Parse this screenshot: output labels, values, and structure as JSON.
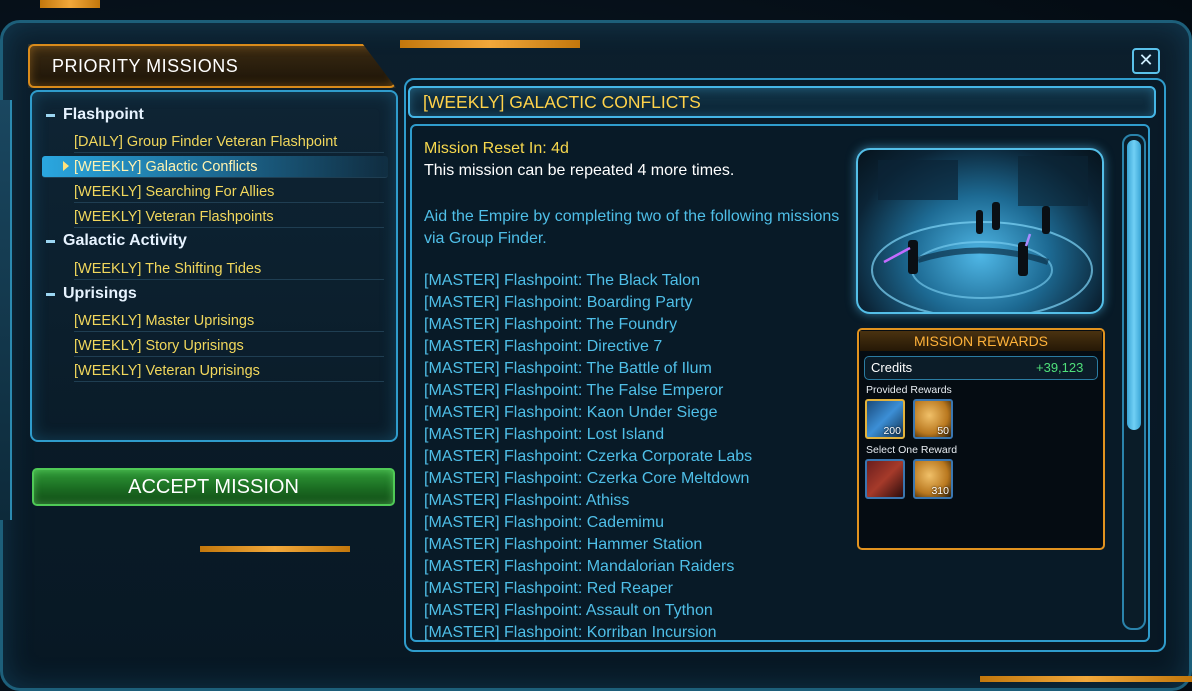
{
  "left_panel": {
    "header": "PRIORITY MISSIONS",
    "categories": [
      {
        "name": "Flashpoint",
        "items": [
          "[DAILY] Group Finder Veteran Flashpoint",
          "[WEEKLY] Galactic Conflicts",
          "[WEEKLY] Searching For Allies",
          "[WEEKLY] Veteran Flashpoints"
        ]
      },
      {
        "name": "Galactic Activity",
        "items": [
          "[WEEKLY] The Shifting Tides"
        ]
      },
      {
        "name": "Uprisings",
        "items": [
          "[WEEKLY] Master Uprisings",
          "[WEEKLY] Story Uprisings",
          "[WEEKLY] Veteran Uprisings"
        ]
      }
    ],
    "selected_item": "[WEEKLY] Galactic Conflicts",
    "accept_button": "ACCEPT MISSION"
  },
  "mission": {
    "title": "[WEEKLY] GALACTIC CONFLICTS",
    "reset": "Mission Reset In: 4d",
    "repeat": "This mission can be repeated 4 more times.",
    "description": "Aid the Empire by completing two of the following missions via Group Finder.",
    "list": [
      "[MASTER] Flashpoint: The Black Talon",
      "[MASTER] Flashpoint: Boarding Party",
      "[MASTER] Flashpoint: The Foundry",
      "[MASTER] Flashpoint: Directive 7",
      "[MASTER] Flashpoint: The Battle of Ilum",
      "[MASTER] Flashpoint: The False Emperor",
      "[MASTER] Flashpoint: Kaon Under Siege",
      "[MASTER] Flashpoint: Lost Island",
      "[MASTER] Flashpoint: Czerka Corporate Labs",
      "[MASTER] Flashpoint: Czerka Core Meltdown",
      "[MASTER] Flashpoint: Athiss",
      "[MASTER] Flashpoint: Cademimu",
      "[MASTER] Flashpoint: Hammer Station",
      "[MASTER] Flashpoint: Mandalorian Raiders",
      "[MASTER] Flashpoint: Red Reaper",
      "[MASTER] Flashpoint: Assault on Tython",
      "[MASTER] Flashpoint: Korriban Incursion"
    ]
  },
  "rewards": {
    "header": "MISSION REWARDS",
    "credits_label": "Credits",
    "credits_value": "+39,123",
    "provided_label": "Provided Rewards",
    "provided": [
      {
        "icon": "conquest-data-icon",
        "qty": "200"
      },
      {
        "icon": "gold-ore-icon",
        "qty": "50"
      }
    ],
    "select_label": "Select One Reward",
    "select": [
      {
        "icon": "crate-icon",
        "qty": ""
      },
      {
        "icon": "gold-ore-icon",
        "qty": "310"
      }
    ]
  },
  "close_label": "✕"
}
